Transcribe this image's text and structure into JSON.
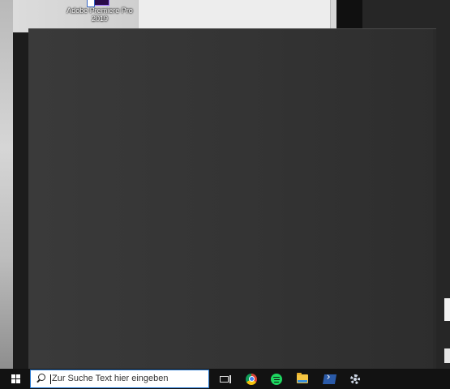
{
  "desktop": {
    "icons": [
      {
        "label": "Adobe Premiere Pro 2019",
        "icon": "premiere-pro-icon"
      }
    ]
  },
  "taskbar": {
    "start_icon": "windows-icon",
    "search": {
      "placeholder": "Zur Suche Text hier eingeben",
      "icon": "search-icon"
    },
    "pinned": [
      {
        "name": "task-view",
        "icon": "task-view-icon"
      },
      {
        "name": "google-chrome",
        "icon": "chrome-icon"
      },
      {
        "name": "spotify",
        "icon": "spotify-icon"
      },
      {
        "name": "file-explorer",
        "icon": "folder-icon"
      },
      {
        "name": "powershell",
        "icon": "powershell-icon"
      },
      {
        "name": "settings",
        "icon": "gear-icon"
      }
    ],
    "colors": {
      "background": "#121212",
      "search_border": "#2b7bd2"
    }
  },
  "main_window": {
    "background": "#333333"
  }
}
